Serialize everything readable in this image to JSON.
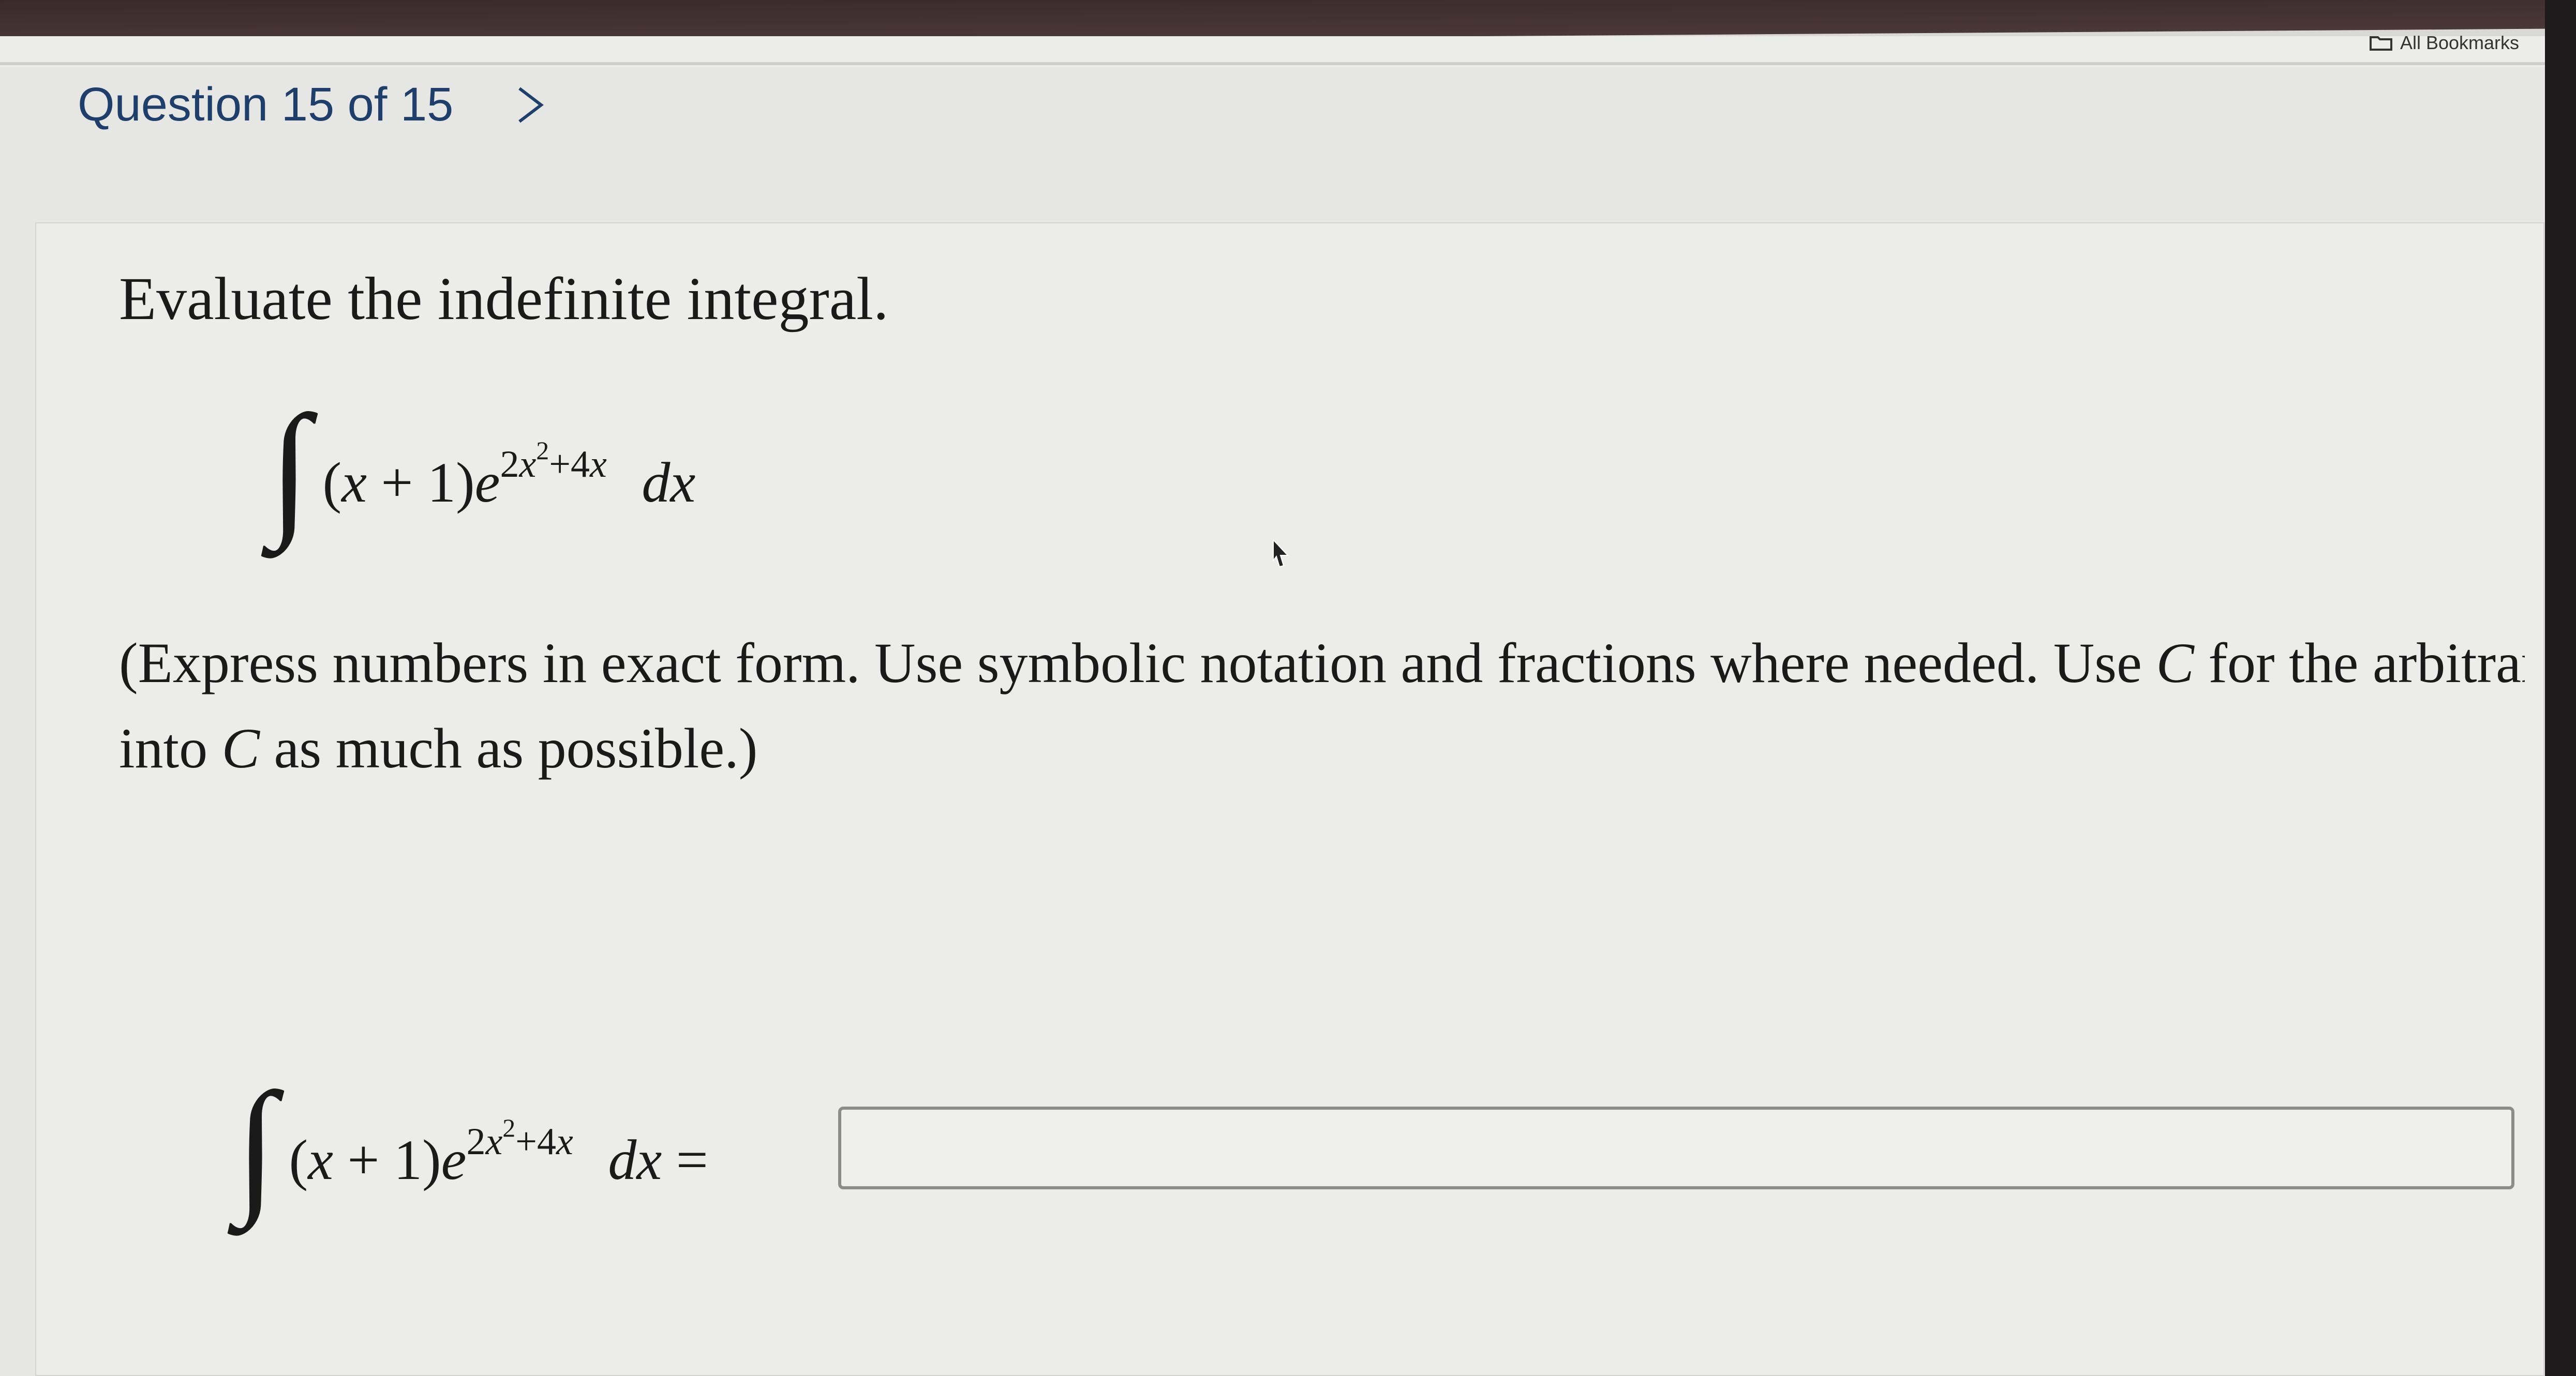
{
  "browser": {
    "bookmarks_label": "All Bookmarks"
  },
  "question": {
    "header": "Question 15 of 15",
    "prompt": "Evaluate the indefinite integral.",
    "integral": {
      "symbol": "∫",
      "lparen": "(",
      "var": "x",
      "plus": " + ",
      "one": "1",
      "rparen": ")",
      "base": "e",
      "exp_coef": "2",
      "exp_var": "x",
      "exp_power": "2",
      "exp_tail": "+4",
      "exp_tail_var": "x",
      "differential": "dx"
    },
    "instructions_1": "(Express numbers in exact form. Use symbolic notation and fractions where needed. Use ",
    "instructions_c": "C",
    "instructions_2": " for the arbitrary cons",
    "instructions_3": "into ",
    "instructions_4": " as much as possible.)",
    "answer_equals": " =",
    "answer_value": ""
  }
}
